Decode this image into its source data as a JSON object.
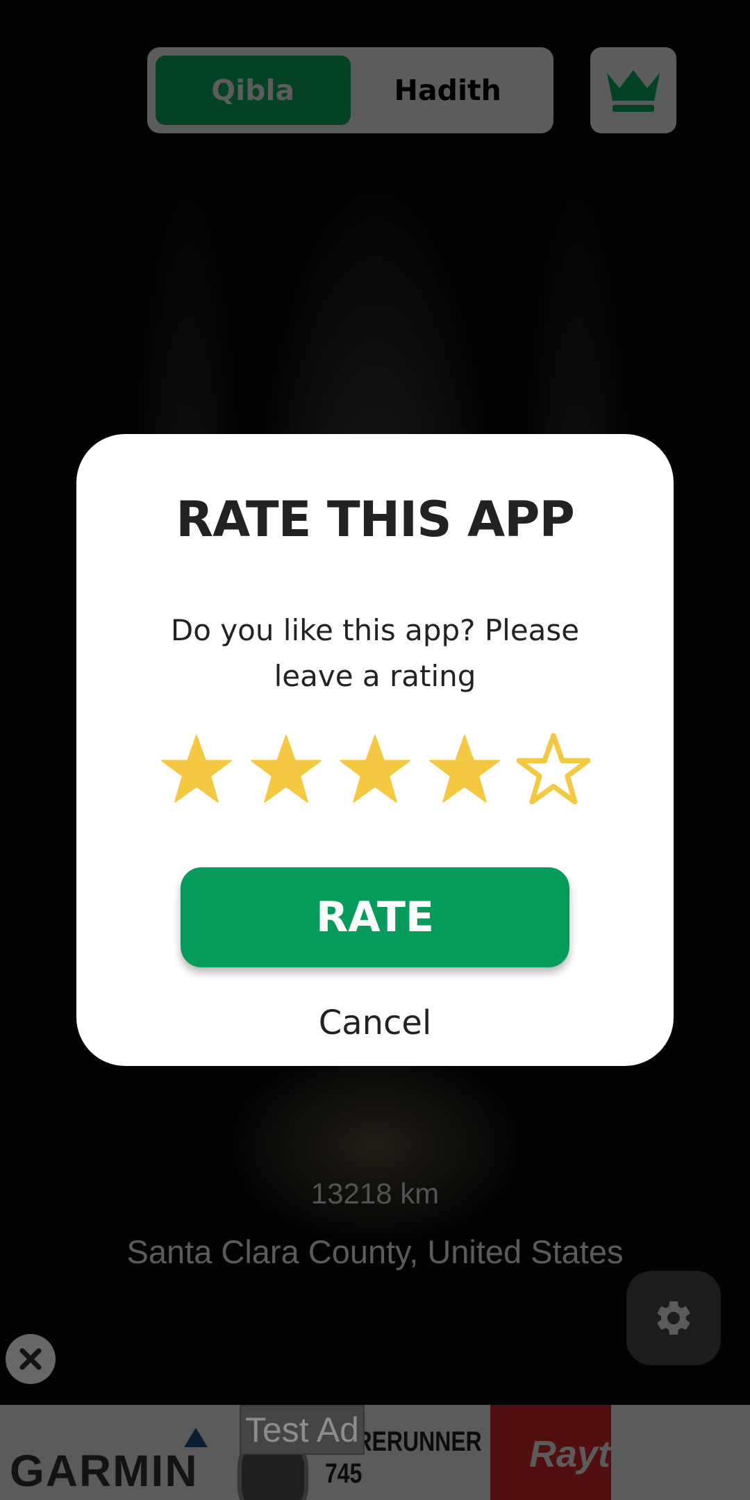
{
  "header": {
    "tabs": [
      {
        "label": "Qibla",
        "active": true
      },
      {
        "label": "Hadith",
        "active": false
      }
    ],
    "premium_icon": "crown-icon"
  },
  "main": {
    "distance": "13218 km",
    "location": "Santa Clara County, United States",
    "settings_icon": "gear-icon"
  },
  "ad": {
    "test_label": "Test Ad",
    "brand": "GARMIN",
    "product_line1": "FORERUNNER",
    "product_line2": "745",
    "partner_text": "Rayt",
    "close_icon": "close-icon"
  },
  "dialog": {
    "title": "RATE THIS APP",
    "message": "Do you like this app? Please leave a rating",
    "rating": 4,
    "max_rating": 5,
    "rate_label": "RATE",
    "cancel_label": "Cancel"
  },
  "colors": {
    "accent": "#079b5b",
    "star": "#f5c842",
    "tab_active": "#05582f"
  }
}
